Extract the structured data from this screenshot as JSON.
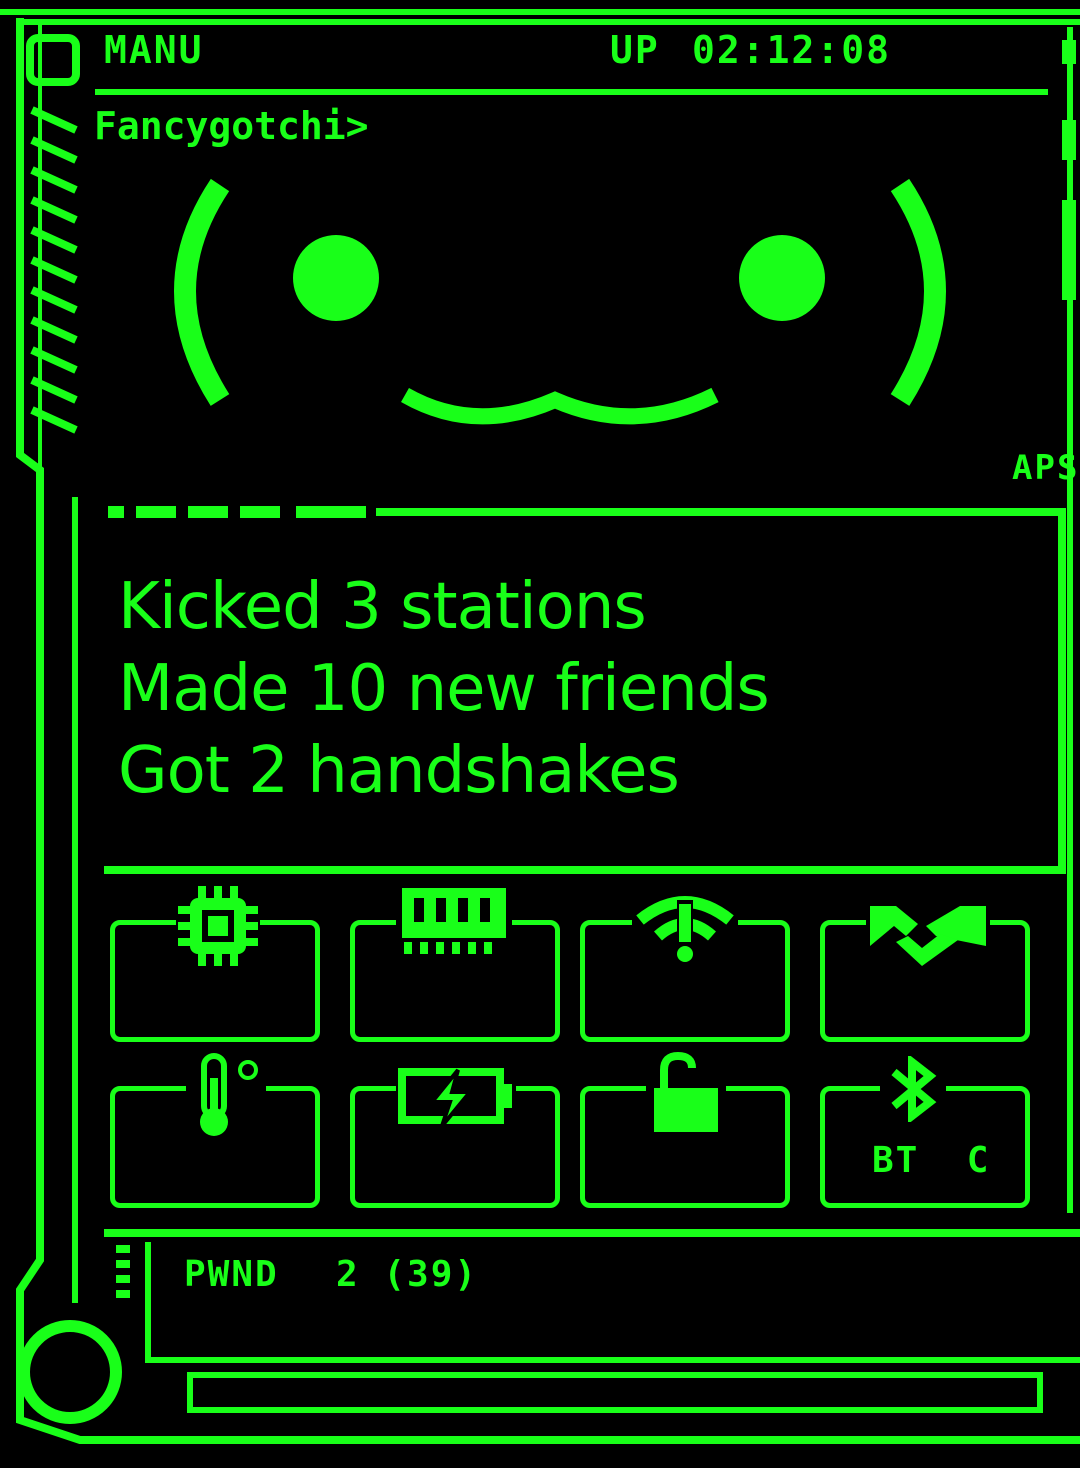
{
  "header": {
    "name": "MANU",
    "uptime_label": "UP",
    "uptime_value": "02:12:08",
    "prompt": "Fancygotchi>",
    "side_tag": "APS"
  },
  "face": {
    "expression": "( ● ‿‿ ● )"
  },
  "stats": {
    "line1": "Kicked 3 stations",
    "line2": "Made 10 new friends",
    "line3": "Got 2 handshakes"
  },
  "tiles": [
    {
      "icon": "cpu-icon",
      "value": ""
    },
    {
      "icon": "memory-icon",
      "value": ""
    },
    {
      "icon": "wifi-warning-icon",
      "value": ""
    },
    {
      "icon": "handshake-icon",
      "value": ""
    },
    {
      "icon": "thermometer-icon",
      "value": ""
    },
    {
      "icon": "battery-charging-icon",
      "value": ""
    },
    {
      "icon": "unlocked-padlock-icon",
      "value": ""
    },
    {
      "icon": "bluetooth-icon",
      "value": "BT  C"
    }
  ],
  "footer": {
    "pwnd_label": "PWND",
    "pwnd_value": "2 (39)"
  },
  "colors": {
    "accent": "#19ff19",
    "background": "#000000"
  }
}
